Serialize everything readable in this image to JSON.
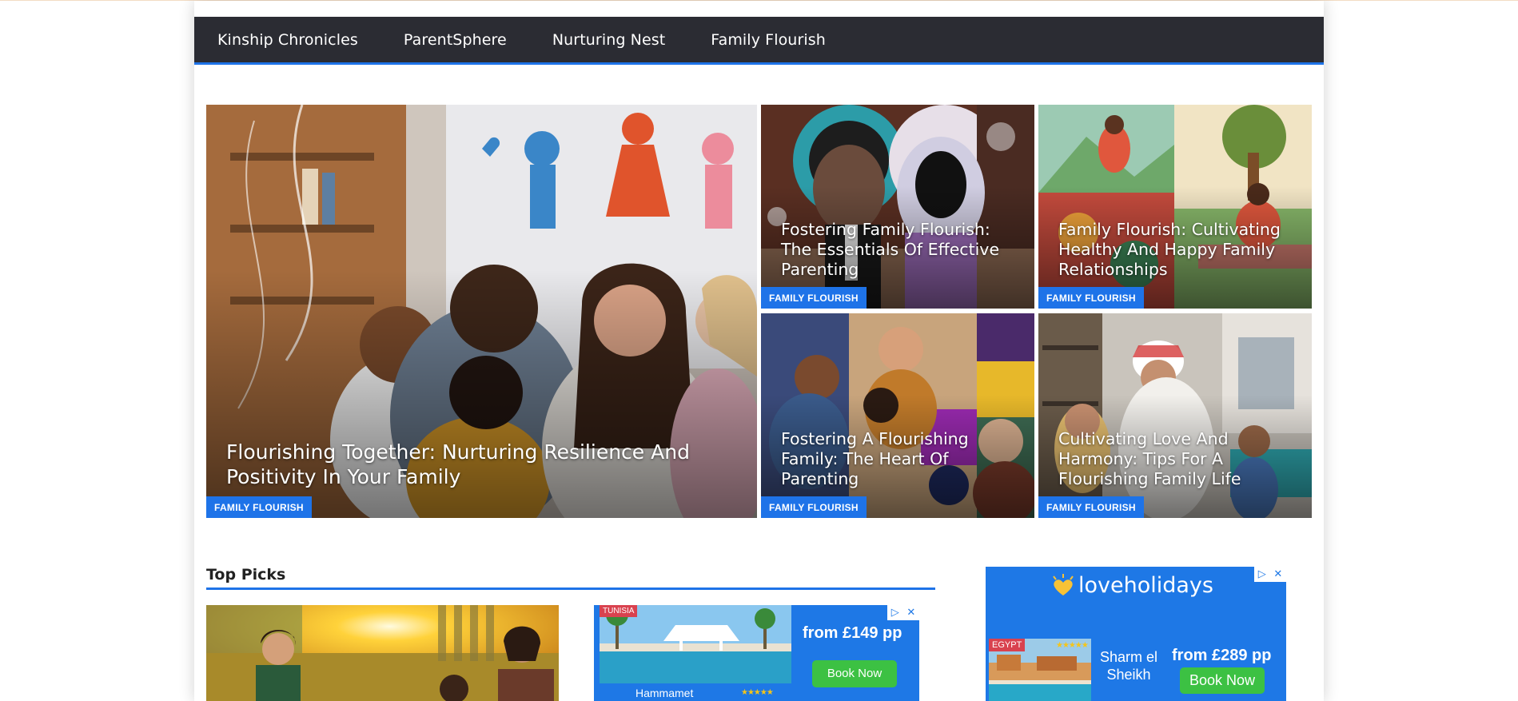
{
  "nav": {
    "items": [
      {
        "label": "Kinship Chronicles"
      },
      {
        "label": "ParentSphere"
      },
      {
        "label": "Nurturing Nest"
      },
      {
        "label": "Family Flourish"
      }
    ]
  },
  "featured": {
    "main": {
      "title": "Flourishing Together: Nurturing Resilience And Positivity In Your Family",
      "category": "FAMILY FLOURISH"
    },
    "cards": [
      {
        "title": "Fostering Family Flourish: The Essentials Of Effective Parenting",
        "category": "FAMILY FLOURISH"
      },
      {
        "title": "Family Flourish: Cultivating Healthy And Happy Family Relationships",
        "category": "FAMILY FLOURISH"
      },
      {
        "title": "Fostering A Flourishing Family: The Heart Of Parenting",
        "category": "FAMILY FLOURISH"
      },
      {
        "title": "Cultivating Love And Harmony: Tips For A Flourishing Family Life",
        "category": "FAMILY FLOURISH"
      }
    ]
  },
  "top_picks": {
    "title": "Top Picks"
  },
  "ad1": {
    "tag": "TUNISIA",
    "place": "Hammamet",
    "stars": "★★★★★",
    "price": "from £149 pp",
    "button": "Book Now"
  },
  "ad2": {
    "brand": "loveholidays",
    "tag": "EGYPT",
    "stars": "★★★★★",
    "place": "Sharm el Sheikh",
    "price": "from £289 pp",
    "button": "Book Now"
  },
  "colors": {
    "accent": "#1e73e8",
    "nav_bg": "#2b2c33",
    "ad_bg": "#1e78e6",
    "ad_button": "#3cc143"
  }
}
